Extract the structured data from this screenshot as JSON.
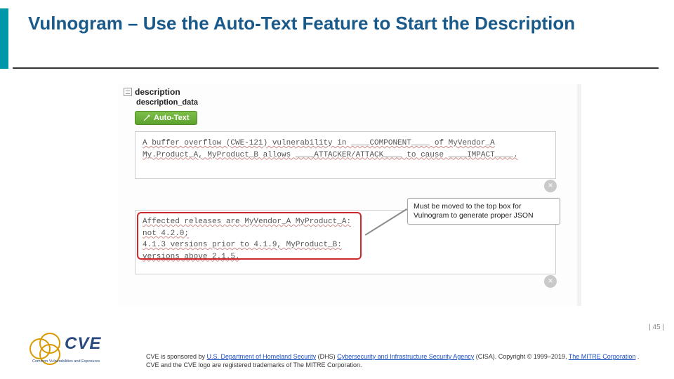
{
  "title": "Vulnogram – Use the Auto-Text Feature to Start the Description",
  "page_number": "| 45 |",
  "screenshot": {
    "section_label": "description",
    "sub_label": "description_data",
    "autotext_label": "Auto-Text",
    "box1_text": "A buffer overflow (CWE-121) vulnerability in ____COMPONENT____ of MyVendor_A My.Product_A, MyProduct_B allows ____ATTACKER/ATTACK____ to cause ____IMPACT____.",
    "box2_line1": "Affected releases are MyVendor_A MyProduct_A:",
    "box2_line2": "not 4.2.0;",
    "box2_line3": "4.1.3 versions prior to 4.1.9, MyProduct_B:",
    "box2_line4": "versions above 2.1.5.",
    "clear_icon": "✕"
  },
  "callout_text": "Must be moved to the top box for Vulnogram to generate proper JSON",
  "footer": {
    "sponsor_prefix": "CVE is sponsored by ",
    "link_dhs": "U.S. Department of Homeland Security",
    "dhs_paren": " (DHS) ",
    "link_cisa": "Cybersecurity and Infrastructure Security Agency",
    "cisa_suffix": " (CISA). Copyright © 1999–2019, ",
    "link_mitre": "The MITRE Corporation",
    "trail": ". CVE and the CVE logo are registered trademarks of The MITRE Corporation."
  },
  "logo": {
    "text": "CVE",
    "sub": "Common Vulnerabilities and Exposures"
  }
}
